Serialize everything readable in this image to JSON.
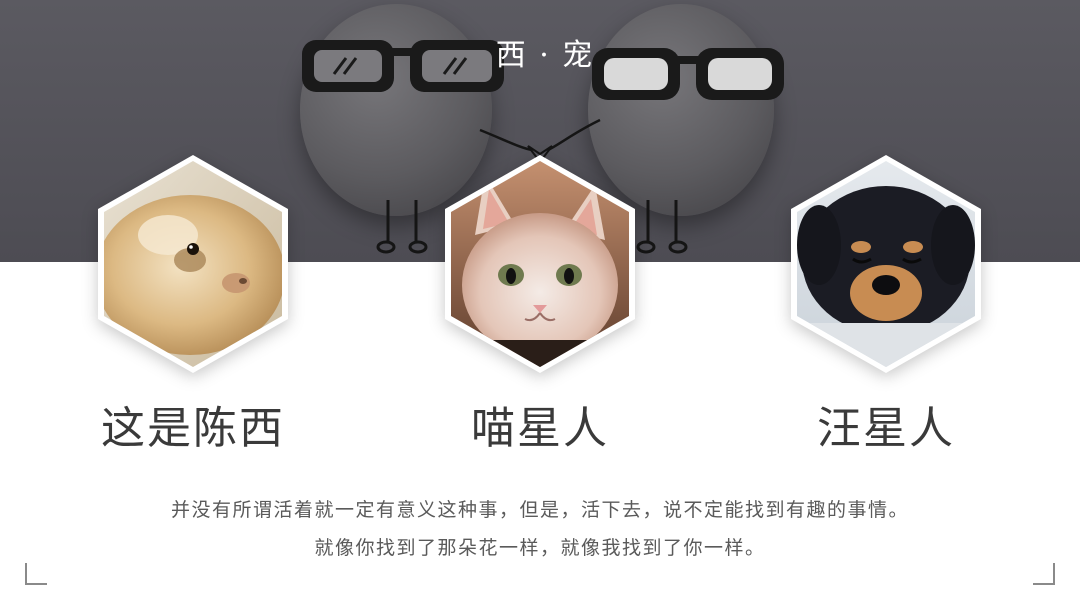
{
  "header": {
    "brand": "西 · 宠"
  },
  "pets": [
    {
      "name": "这是陈西",
      "image": "guinea-pig-photo"
    },
    {
      "name": "喵星人",
      "image": "kitten-photo"
    },
    {
      "name": "汪星人",
      "image": "puppy-photo"
    }
  ],
  "quote": {
    "line1": "并没有所谓活着就一定有意义这种事，但是，活下去，说不定能找到有趣的事情。",
    "line2": "就像你找到了那朵花一样，就像我找到了你一样。"
  },
  "colors": {
    "banner": "#55545b",
    "text": "#3a3a3a",
    "quote": "#5a5a5a"
  }
}
